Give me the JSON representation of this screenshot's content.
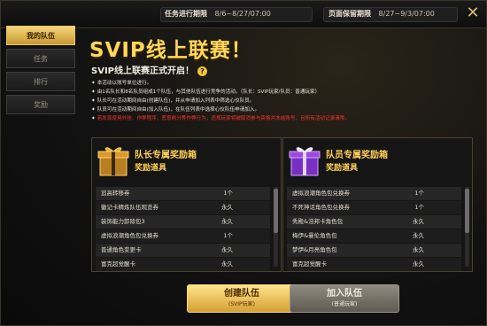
{
  "header": {
    "task_period_label": "任务进行期限",
    "task_period_value": "8/6~8/27/07:00",
    "page_period_label": "页面保留期限",
    "page_period_value": "8/27~9/3/07:00",
    "close_label": "✕"
  },
  "sidebar": {
    "items": [
      {
        "label": "我的队伍",
        "active": true
      },
      {
        "label": "任务",
        "active": false
      },
      {
        "label": "排行",
        "active": false
      },
      {
        "label": "奖励",
        "active": false
      }
    ]
  },
  "main": {
    "title": "SVIP线上联赛！",
    "subtitle": "SVIP线上联赛正式开启！",
    "help_icon": "?",
    "rules": [
      "本活动以账号单位进行。",
      "由1名队长和8名队员组成1个队伍，与其他队伍进行竞争的活动。（队长：SVIP玩家/队员：普通玩家）",
      "队长可在活动期间自由(创建队伍)，并从申请加入列表中筛选心仪队员。",
      "队员可在活动期间自由(加入队伍)，在队伍列表中选择心仪队伍申请加入。",
      "若发现使用外挂、作弊程序、恶意刷分等作弊行为，违规玩家将被取消参与资格并冻结账号，且所有活动记录清零。"
    ]
  },
  "reward_boxes": [
    {
      "title": "队长专属奖励箱",
      "subtitle": "奖励道具",
      "gift_color": "#d8a13a",
      "items": [
        {
          "name": "追高转移券",
          "duration": "1个"
        },
        {
          "name": "徽记卡精炼队伍观览券",
          "duration": "永久"
        },
        {
          "name": "装饰能力卸除包3",
          "duration": "永久"
        },
        {
          "name": "虚拟浪潮角色包兑换券",
          "duration": "1个"
        },
        {
          "name": "普通角色变更卡",
          "duration": "永久"
        },
        {
          "name": "富克超觉醒卡",
          "duration": "永久"
        }
      ]
    },
    {
      "title": "队员专属奖励箱",
      "subtitle": "奖励道具",
      "gift_color": "#8b3fd8",
      "items": [
        {
          "name": "虚拟浪潮角色包兑换券",
          "duration": "1个"
        },
        {
          "name": "不死神话角色包兑换券",
          "duration": "1个"
        },
        {
          "name": "秀殿&浩邦卡角色包",
          "duration": "永久"
        },
        {
          "name": "梅伊&曼伦角色包",
          "duration": "永久"
        },
        {
          "name": "梦伊&月亮角色包",
          "duration": "永久"
        },
        {
          "name": "富克超觉醒卡",
          "duration": "永久"
        }
      ]
    }
  ],
  "buttons": {
    "create_label": "创建队伍",
    "create_sub": "(SVIP玩家)",
    "join_label": "加入队伍",
    "join_sub": "(普通玩家)"
  }
}
